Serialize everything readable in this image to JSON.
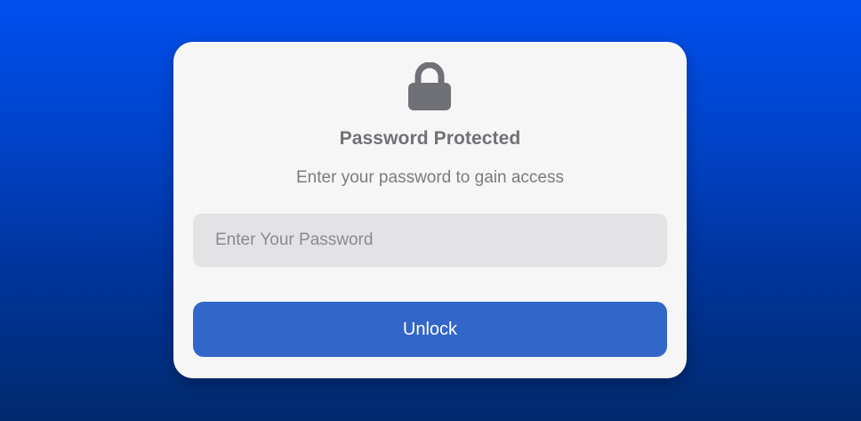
{
  "lock": {
    "icon": "lock-icon",
    "color": "#707077"
  },
  "title": "Password Protected",
  "subtitle": "Enter your password to gain access",
  "password_field": {
    "value": "",
    "placeholder": "Enter Your Password"
  },
  "unlock_button": {
    "label": "Unlock",
    "color": "#3366c9"
  },
  "colors": {
    "card_background": "#f6f6f6",
    "background_top": "#0050f0",
    "background_bottom": "#002a6e"
  }
}
